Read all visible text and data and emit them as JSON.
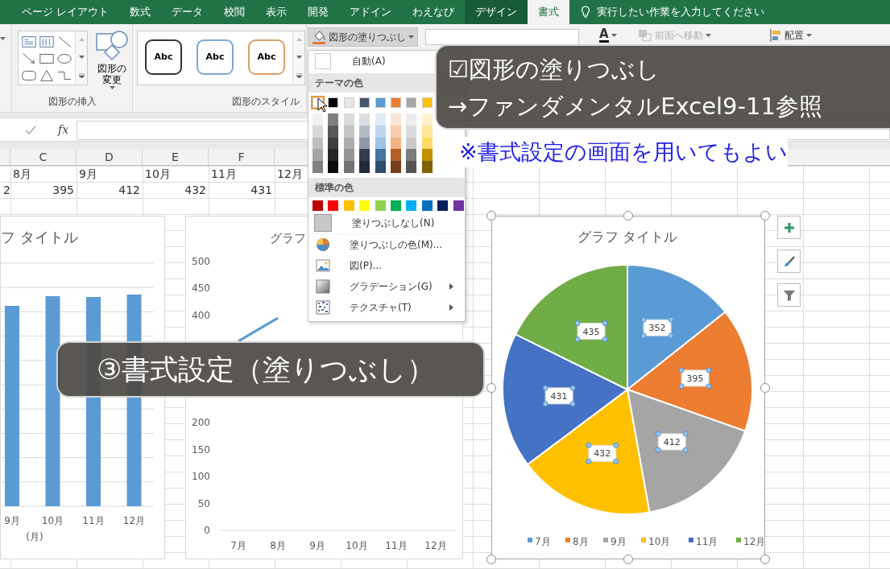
{
  "tabs": [
    {
      "label": "ページ レイアウト",
      "selected": false,
      "contextual": false
    },
    {
      "label": "数式",
      "selected": false,
      "contextual": false
    },
    {
      "label": "データ",
      "selected": false,
      "contextual": false
    },
    {
      "label": "校閲",
      "selected": false,
      "contextual": false
    },
    {
      "label": "表示",
      "selected": false,
      "contextual": false
    },
    {
      "label": "開発",
      "selected": false,
      "contextual": false
    },
    {
      "label": "アドイン",
      "selected": false,
      "contextual": false
    },
    {
      "label": "わえなび",
      "selected": false,
      "contextual": false
    },
    {
      "label": "デザイン",
      "selected": false,
      "contextual": true
    },
    {
      "label": "書式",
      "selected": true,
      "contextual": true
    }
  ],
  "tell_me": {
    "placeholder": "実行したい作業を入力してください"
  },
  "ribbon": {
    "insert_shapes": {
      "change_shape_button": "図形の変更",
      "label": "図形の挿入"
    },
    "shape_styles": {
      "presets": [
        {
          "label": "Abc",
          "color": "#333333"
        },
        {
          "label": "Abc",
          "color": "#7ba7d7"
        },
        {
          "label": "Abc",
          "color": "#d9a066"
        }
      ],
      "label": "図形のスタイル"
    },
    "shape_fill_button": {
      "label": "図形の塗りつぶし",
      "pressed": true
    },
    "text_fill_button": {
      "label": "A"
    },
    "bring_forward_button": {
      "label": "前面へ移動",
      "disabled": true
    },
    "arrange_button": {
      "label": "配置",
      "disabled": false
    }
  },
  "formula_bar": {
    "function_label": "fx"
  },
  "columns": [
    "C",
    "D",
    "E",
    "F"
  ],
  "rows": [
    {
      "kind": "text",
      "cells": [
        null,
        "8月",
        "9月",
        "10月",
        "11月",
        "12月"
      ]
    },
    {
      "kind": "number",
      "cells": [
        "2",
        "395",
        "412",
        "432",
        "431",
        null
      ]
    }
  ],
  "charts": [
    {
      "kind": "bar",
      "title": "フ タイトル",
      "categories": [
        "9月",
        "10月",
        "11月",
        "12月"
      ],
      "axis_label": "(月)",
      "selected": false
    },
    {
      "kind": "line",
      "selected": false,
      "chart_data": {
        "type": "line",
        "title": "グラフ",
        "categories": [
          "7月",
          "8月",
          "9月",
          "10月",
          "11月",
          "12月"
        ],
        "series": [
          {
            "color": "#5b9bd5",
            "values": [
              352,
              395,
              null,
              null,
              null,
              null
            ]
          }
        ],
        "ylim": [
          0,
          500
        ],
        "yticks": [
          0,
          50,
          100,
          150,
          200,
          400,
          450,
          500
        ]
      }
    },
    {
      "kind": "pie",
      "selected": true,
      "chart_data": {
        "type": "pie",
        "title": "グラフ タイトル",
        "categories": [
          "7月",
          "8月",
          "9月",
          "10月",
          "11月",
          "12月"
        ],
        "values": [
          352,
          395,
          412,
          432,
          431,
          435
        ],
        "data_labels": true,
        "legend": "bottom"
      },
      "legend": [
        {
          "color": "#5b9bd5"
        },
        {
          "color": "#ed7d31"
        },
        {
          "color": "#a5a5a5"
        },
        {
          "color": "#ffc000"
        },
        {
          "color": "#4472c4"
        },
        {
          "color": "#70ad47"
        }
      ]
    }
  ],
  "fill_menu": {
    "auto": "自動(A)",
    "theme_header": "テーマの色",
    "theme_colors": [
      {
        "color": "#ffffff",
        "selected": true
      },
      {
        "color": "#000000",
        "selected": false
      },
      {
        "color": "#e7e6e6",
        "selected": false
      },
      {
        "color": "#44546a",
        "selected": false
      },
      {
        "color": "#5b9bd5",
        "selected": false
      },
      {
        "color": "#ed7d31",
        "selected": false
      },
      {
        "color": "#a5a5a5",
        "selected": false
      },
      {
        "color": "#ffc000",
        "selected": false
      }
    ],
    "standard_header": "標準の色",
    "standard_colors": [
      {
        "color": "#c00000"
      },
      {
        "color": "#ff0000"
      },
      {
        "color": "#ffc000"
      },
      {
        "color": "#ffff00"
      },
      {
        "color": "#92d050"
      },
      {
        "color": "#00b050"
      },
      {
        "color": "#00b0f0"
      },
      {
        "color": "#0070c0"
      },
      {
        "color": "#002060"
      },
      {
        "color": "#7030a0"
      }
    ],
    "no_fill": "塗りつぶしなし(N)",
    "items": [
      {
        "label": "塗りつぶしの色(M)...",
        "kind": "palette",
        "submenu": false
      },
      {
        "label": "図(P)...",
        "kind": "picture",
        "submenu": false
      },
      {
        "label": "グラデーション(G)",
        "kind": "gradient",
        "submenu": true
      },
      {
        "label": "テクスチャ(T)",
        "kind": "texture",
        "submenu": true
      }
    ]
  },
  "callouts": [
    {
      "kind": "top",
      "lines": [
        "☑図形の塗りつぶし",
        "→ファンダメンタルExcel9-11参照"
      ]
    },
    {
      "kind": "middle",
      "lines": [
        "③書式設定（塗りつぶし）"
      ]
    }
  ],
  "note": "※書式設定の画面を用いてもよい"
}
